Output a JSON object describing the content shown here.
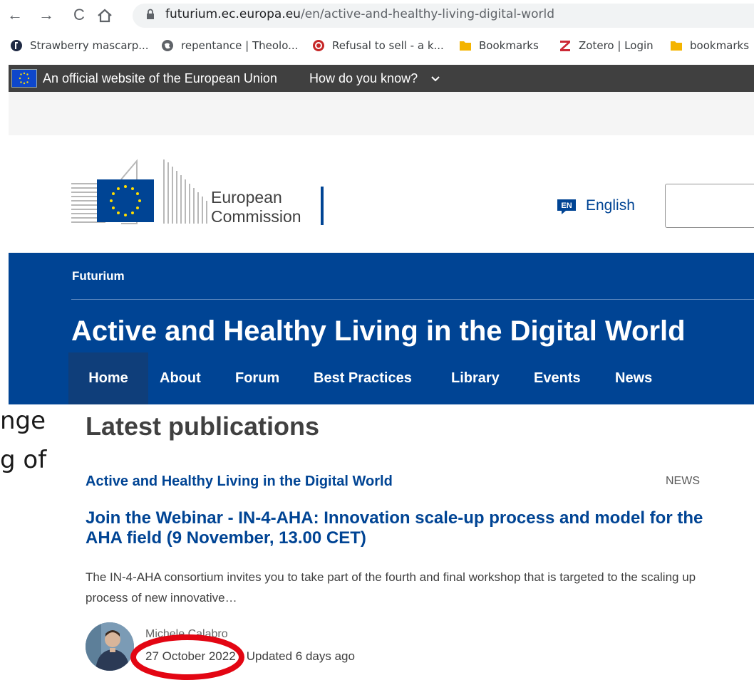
{
  "browser": {
    "url_host": "futurium.ec.europa.eu",
    "url_path": "/en/active-and-healthy-living-digital-world",
    "bookmarks": [
      {
        "label": "Strawberry mascarp...",
        "icon": "site-globe-dark-icon"
      },
      {
        "label": "repentance | Theolo...",
        "icon": "globe-icon"
      },
      {
        "label": "Refusal to sell - a k...",
        "icon": "target-icon"
      },
      {
        "label": "Bookmarks",
        "icon": "folder-icon"
      },
      {
        "label": "Zotero | Login",
        "icon": "zotero-z-icon"
      },
      {
        "label": "bookmarks",
        "icon": "folder-icon"
      }
    ]
  },
  "eu_banner": {
    "official_text": "An official website of the European Union",
    "how_know": "How do you know?"
  },
  "header": {
    "org_line1": "European",
    "org_line2": "Commission",
    "lang_code": "EN",
    "lang_label": "English"
  },
  "site": {
    "name": "Futurium",
    "title": "Active and Healthy Living in the Digital World",
    "menu": [
      "Home",
      "About",
      "Forum",
      "Best Practices",
      "Library",
      "Events",
      "News"
    ]
  },
  "fragments": [
    "nge",
    "g of"
  ],
  "content": {
    "section_title": "Latest publications",
    "category": "Active and Healthy Living in the Digital World",
    "type": "NEWS",
    "headline": "Join the Webinar - IN-4-AHA: Innovation scale-up process and model for the AHA field (9 November, 13.00 CET)",
    "teaser": "The IN-4-AHA consortium invites you to take part of the fourth and final workshop that is targeted to the scaling up process of new innovative…",
    "author": "Michele Calabro",
    "date": "27 October 2022",
    "date_sep": " - ",
    "updated": "Updated 6 days ago"
  },
  "colors": {
    "ec_blue": "#004494",
    "banner_grey": "#404040",
    "highlight_red": "#e30613"
  }
}
